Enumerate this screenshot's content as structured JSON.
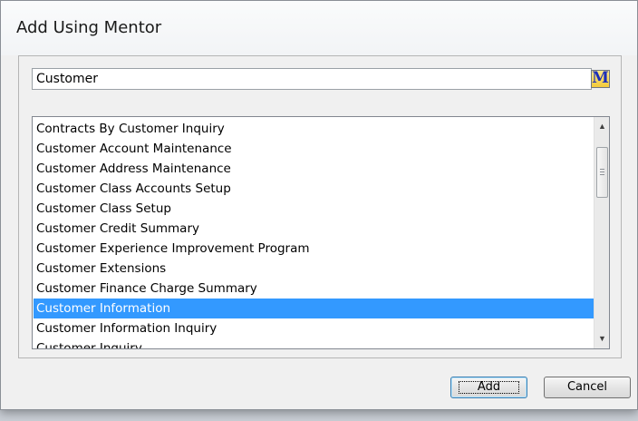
{
  "dialog": {
    "title": "Add Using Mentor"
  },
  "search": {
    "value": "Customer",
    "mentor_button_label": "M"
  },
  "list": {
    "items": [
      "Contracts By Customer Inquiry",
      "Customer Account Maintenance",
      "Customer Address Maintenance",
      "Customer Class Accounts Setup",
      "Customer Class Setup",
      "Customer Credit Summary",
      "Customer Experience Improvement Program",
      "Customer Extensions",
      "Customer Finance Charge Summary",
      "Customer Information",
      "Customer Information Inquiry",
      "Customer Inquiry"
    ],
    "selected_item": "Customer Information"
  },
  "buttons": {
    "add_label": "Add",
    "cancel_label": "Cancel"
  },
  "colors": {
    "selection": "#3399ff",
    "mentor_icon_bg": "#f3c93a",
    "mentor_icon_text": "#1c2fb8"
  },
  "icons": {
    "scroll_up": "triangle-up-icon",
    "scroll_down": "triangle-down-icon",
    "mentor": "mentor-m-icon"
  }
}
